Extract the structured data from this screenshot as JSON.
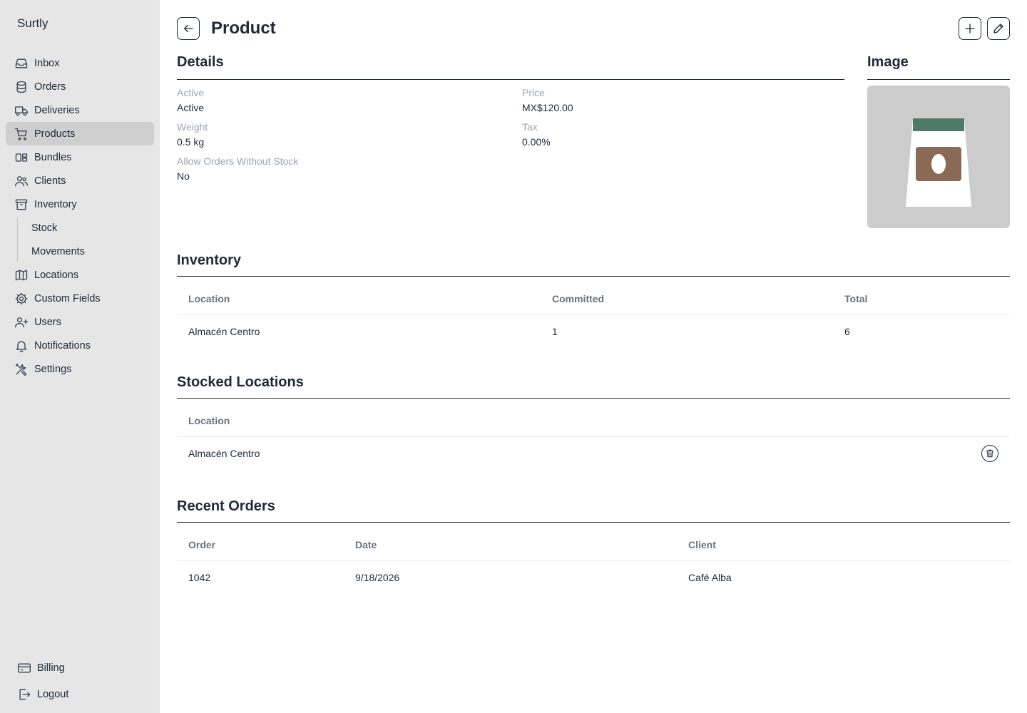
{
  "app": {
    "name": "Surtly"
  },
  "sidebar": {
    "items": [
      {
        "label": "Inbox",
        "icon": "inbox-icon"
      },
      {
        "label": "Orders",
        "icon": "database-icon"
      },
      {
        "label": "Deliveries",
        "icon": "truck-icon"
      },
      {
        "label": "Products",
        "icon": "cart-icon",
        "active": true
      },
      {
        "label": "Bundles",
        "icon": "bundles-icon"
      },
      {
        "label": "Clients",
        "icon": "users-icon"
      },
      {
        "label": "Inventory",
        "icon": "archive-icon"
      }
    ],
    "sub_items": [
      {
        "label": "Stock"
      },
      {
        "label": "Movements"
      }
    ],
    "items_after": [
      {
        "label": "Locations",
        "icon": "map-icon"
      },
      {
        "label": "Custom Fields",
        "icon": "cog-icon"
      },
      {
        "label": "Users",
        "icon": "user-plus-icon"
      },
      {
        "label": "Notifications",
        "icon": "bell-icon"
      },
      {
        "label": "Settings",
        "icon": "tools-icon"
      }
    ],
    "bottom": [
      {
        "label": "Billing",
        "icon": "credit-card-icon"
      },
      {
        "label": "Logout",
        "icon": "logout-icon"
      }
    ]
  },
  "header": {
    "title": "Product"
  },
  "details": {
    "title": "Details",
    "fields": {
      "active": {
        "label": "Active",
        "value": "Active"
      },
      "price": {
        "label": "Price",
        "value": "MX$120.00"
      },
      "weight": {
        "label": "Weight",
        "value": "0.5 kg"
      },
      "tax": {
        "label": "Tax",
        "value": "0.00%"
      },
      "allow": {
        "label": "Allow Orders Without Stock",
        "value": "No"
      }
    }
  },
  "image": {
    "title": "Image"
  },
  "inventory": {
    "title": "Inventory",
    "columns": [
      "Location",
      "Committed",
      "Total"
    ],
    "rows": [
      [
        "Almacén Centro",
        "1",
        "6"
      ]
    ]
  },
  "stocked": {
    "title": "Stocked Locations",
    "columns": [
      "Location"
    ],
    "rows": [
      [
        "Almacén Centro"
      ]
    ]
  },
  "orders": {
    "title": "Recent Orders",
    "columns": [
      "Order",
      "Date",
      "Client"
    ],
    "rows": [
      [
        "1042",
        "9/18/2026",
        "Café Alba"
      ]
    ]
  },
  "colors": {
    "sidebar_bg": "#e6e6e6",
    "active_item_bg": "#cfcfcf",
    "text": "#1f2937",
    "muted": "#9ca3af",
    "image_bg": "#cccccc",
    "bag_top": "#4f7a6a",
    "bag_label": "#8b6a55"
  }
}
